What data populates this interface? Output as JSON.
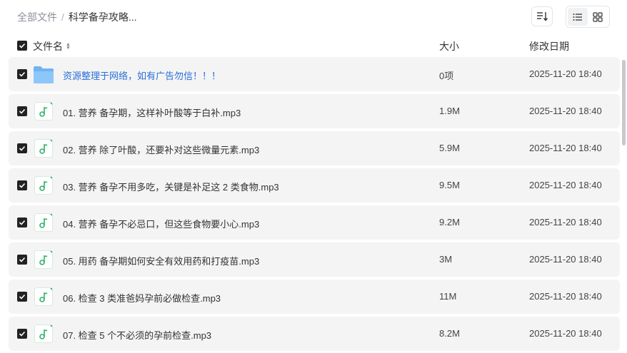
{
  "breadcrumb": {
    "root": "全部文件",
    "separator": "/",
    "current": "科学备孕攻略..."
  },
  "toolbar": {
    "sort_icon": "sort-lines-icon",
    "view_list_icon": "list-view-icon",
    "view_grid_icon": "grid-view-icon",
    "active_view": "list"
  },
  "table": {
    "columns": {
      "name": "文件名",
      "size": "大小",
      "modified": "修改日期"
    },
    "rows": [
      {
        "type": "folder",
        "name": "资源整理于网络，如有广告勿信！！！",
        "size": "0项",
        "date": "2025-11-20 18:40"
      },
      {
        "type": "audio",
        "name": "01. 营养 备孕期，这样补叶酸等于白补.mp3",
        "size": "1.9M",
        "date": "2025-11-20 18:40"
      },
      {
        "type": "audio",
        "name": "02. 营养 除了叶酸，还要补对这些微量元素.mp3",
        "size": "5.9M",
        "date": "2025-11-20 18:40"
      },
      {
        "type": "audio",
        "name": "03. 营养 备孕不用多吃，关键是补足这 2 类食物.mp3",
        "size": "9.5M",
        "date": "2025-11-20 18:40"
      },
      {
        "type": "audio",
        "name": "04. 营养 备孕不必忌口，但这些食物要小心.mp3",
        "size": "9.2M",
        "date": "2025-11-20 18:40"
      },
      {
        "type": "audio",
        "name": "05. 用药 备孕期如何安全有效用药和打疫苗.mp3",
        "size": "3M",
        "date": "2025-11-20 18:40"
      },
      {
        "type": "audio",
        "name": "06. 检查 3 类准爸妈孕前必做检查.mp3",
        "size": "11M",
        "date": "2025-11-20 18:40"
      },
      {
        "type": "audio",
        "name": "07. 检查 5 个不必须的孕前检查.mp3",
        "size": "8.2M",
        "date": "2025-11-20 18:40"
      }
    ]
  },
  "colors": {
    "folder_name": "#2a6fd6",
    "row_background": "#f4f4f5",
    "audio_icon_green": "#2fb36a"
  }
}
